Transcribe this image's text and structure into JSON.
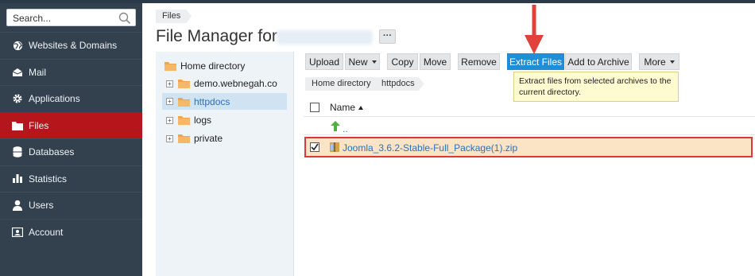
{
  "sidebar": {
    "search_placeholder": "Search...",
    "items": [
      {
        "label": "Websites & Domains",
        "icon": "globe-icon"
      },
      {
        "label": "Mail",
        "icon": "mail-icon"
      },
      {
        "label": "Applications",
        "icon": "gear-icon"
      },
      {
        "label": "Files",
        "icon": "folder-icon",
        "active": true
      },
      {
        "label": "Databases",
        "icon": "database-icon"
      },
      {
        "label": "Statistics",
        "icon": "bar-chart-icon"
      },
      {
        "label": "Users",
        "icon": "user-icon"
      },
      {
        "label": "Account",
        "icon": "account-icon"
      }
    ]
  },
  "breadcrumb": {
    "top": "Files"
  },
  "header": {
    "title": "File Manager for",
    "more_label": "···"
  },
  "tree": {
    "root": "Home directory",
    "items": [
      {
        "label": "demo.webnegah.co"
      },
      {
        "label": "httpdocs",
        "selected": true
      },
      {
        "label": "logs"
      },
      {
        "label": "private"
      }
    ]
  },
  "toolbar": {
    "upload": "Upload",
    "new": "New",
    "copy": "Copy",
    "move": "Move",
    "remove": "Remove",
    "extract": "Extract Files",
    "add_archive": "Add to Archive",
    "more": "More"
  },
  "tooltip": {
    "text": "Extract files from selected archives to the current directory."
  },
  "path": {
    "items": [
      "Home directory",
      "httpdocs"
    ]
  },
  "table": {
    "column_name": "Name",
    "up_label": "..",
    "file": "Joomla_3.6.2-Stable-Full_Package(1).zip"
  },
  "colors": {
    "accent": "#1f8ed9",
    "active_nav": "#b4161b",
    "sidebar": "#33414f",
    "selection": "#fbe3c6",
    "highlight_border": "#d83a3a",
    "arrow": "#e0413a"
  }
}
